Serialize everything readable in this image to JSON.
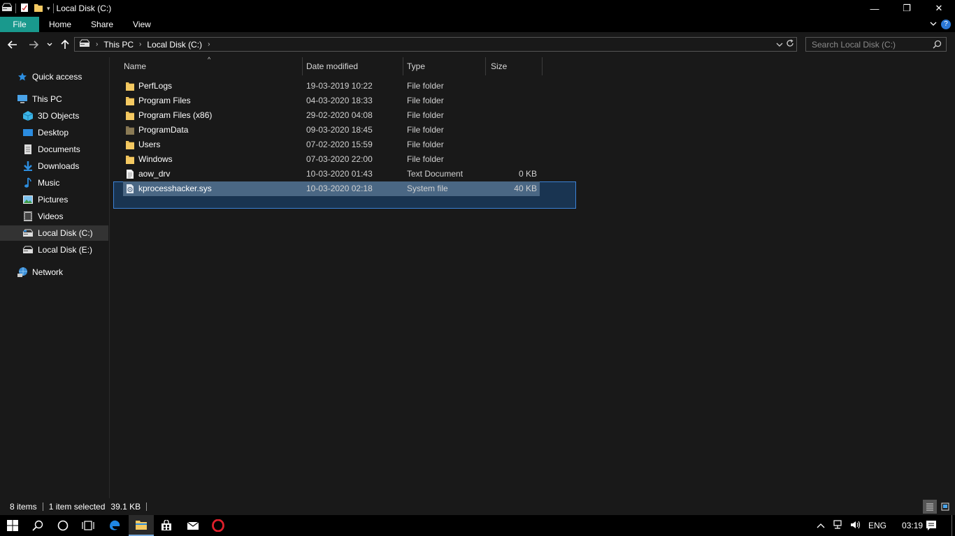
{
  "window": {
    "title": "Local Disk (C:)",
    "controls": {
      "minimize": "—",
      "maximize": "❐",
      "close": "✕"
    }
  },
  "ribbon": {
    "tabs": [
      {
        "label": "File"
      },
      {
        "label": "Home"
      },
      {
        "label": "Share"
      },
      {
        "label": "View"
      }
    ]
  },
  "address": {
    "crumbs": [
      "This PC",
      "Local Disk (C:)"
    ]
  },
  "search": {
    "placeholder": "Search Local Disk (C:)"
  },
  "sidebar": {
    "quick_access": "Quick access",
    "this_pc": "This PC",
    "items": [
      {
        "label": "3D Objects",
        "icon": "3d-objects-icon"
      },
      {
        "label": "Desktop",
        "icon": "desktop-icon"
      },
      {
        "label": "Documents",
        "icon": "documents-icon"
      },
      {
        "label": "Downloads",
        "icon": "downloads-icon"
      },
      {
        "label": "Music",
        "icon": "music-icon"
      },
      {
        "label": "Pictures",
        "icon": "pictures-icon"
      },
      {
        "label": "Videos",
        "icon": "videos-icon"
      },
      {
        "label": "Local Disk (C:)",
        "icon": "drive-icon",
        "selected": true
      },
      {
        "label": "Local Disk (E:)",
        "icon": "drive-icon"
      }
    ],
    "network": "Network"
  },
  "columns": {
    "name": "Name",
    "date": "Date modified",
    "type": "Type",
    "size": "Size"
  },
  "files": [
    {
      "name": "PerfLogs",
      "date": "19-03-2019 10:22",
      "type": "File folder",
      "size": "",
      "icon": "folder-icon"
    },
    {
      "name": "Program Files",
      "date": "04-03-2020 18:33",
      "type": "File folder",
      "size": "",
      "icon": "folder-icon"
    },
    {
      "name": "Program Files (x86)",
      "date": "29-02-2020 04:08",
      "type": "File folder",
      "size": "",
      "icon": "folder-icon"
    },
    {
      "name": "ProgramData",
      "date": "09-03-2020 18:45",
      "type": "File folder",
      "size": "",
      "icon": "hidden-folder-icon"
    },
    {
      "name": "Users",
      "date": "07-02-2020 15:59",
      "type": "File folder",
      "size": "",
      "icon": "folder-icon"
    },
    {
      "name": "Windows",
      "date": "07-03-2020 22:00",
      "type": "File folder",
      "size": "",
      "icon": "folder-icon"
    },
    {
      "name": "aow_drv",
      "date": "10-03-2020 01:43",
      "type": "Text Document",
      "size": "0 KB",
      "icon": "text-document-icon"
    },
    {
      "name": "kprocesshacker.sys",
      "date": "10-03-2020 02:18",
      "type": "System file",
      "size": "40 KB",
      "icon": "system-file-icon",
      "selected": true
    }
  ],
  "status": {
    "items": "8 items",
    "selected": "1 item selected",
    "size": "39.1 KB"
  },
  "tray": {
    "language": "ENG",
    "time": "03:19"
  },
  "colors": {
    "file_tab": "#19998d",
    "selection": "#4a6784",
    "folder": "#f4c962",
    "accent": "#3d82d6"
  }
}
